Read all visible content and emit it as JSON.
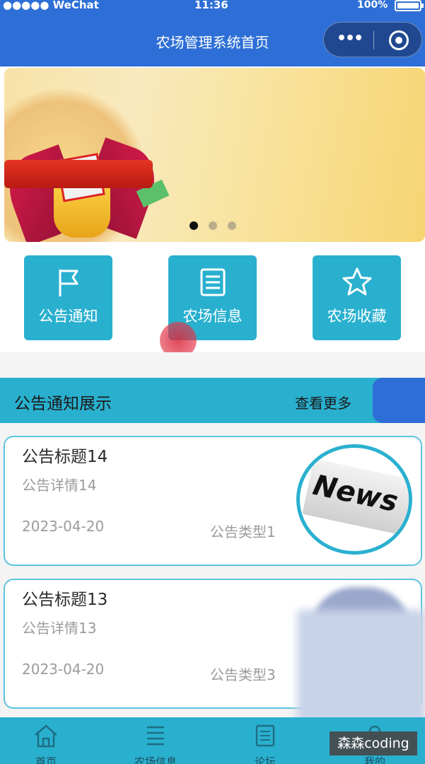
{
  "status_bar": {
    "carrier": "●●●●● WeChat",
    "time": "11:36",
    "battery": "100%"
  },
  "nav": {
    "title": "农场管理系统首页"
  },
  "banner": {
    "slides": 3,
    "active_index": 0
  },
  "quick_links": [
    {
      "label": "公告通知",
      "icon": "flag-icon"
    },
    {
      "label": "农场信息",
      "icon": "document-icon"
    },
    {
      "label": "农场收藏",
      "icon": "star-icon"
    }
  ],
  "section": {
    "title": "公告通知展示",
    "more": "查看更多"
  },
  "notices": [
    {
      "title": "公告标题14",
      "detail": "公告详情14",
      "date": "2023-04-20",
      "type": "公告类型1",
      "thumb": "News"
    },
    {
      "title": "公告标题13",
      "detail": "公告详情13",
      "date": "2023-04-20",
      "type": "公告类型3"
    }
  ],
  "tabbar": [
    {
      "label": "首页",
      "icon": "home-icon"
    },
    {
      "label": "农场信息",
      "icon": "list-icon"
    },
    {
      "label": "论坛",
      "icon": "forum-icon"
    },
    {
      "label": "我的",
      "icon": "user-icon"
    }
  ],
  "watermark": "森森coding",
  "colors": {
    "primary": "#2d6fd6",
    "accent": "#2ab0cf",
    "touch_indicator": "#dc2a3c"
  }
}
